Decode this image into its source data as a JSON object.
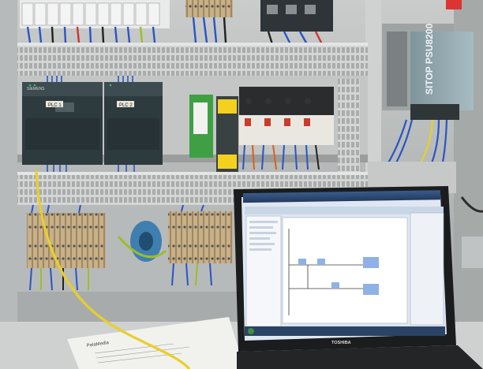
{
  "photo": {
    "plc_module_1_label": "PLC 1",
    "plc_module_2_label": "PLC 2",
    "plc_brand_label": "SIEMENS",
    "psu_label": "SITOP PSU8200",
    "laptop_brand": "TOSHIBA",
    "document_logo_text": "PelaMedia"
  },
  "colors": {
    "cabinet": "#b9bbbb",
    "plc_body": "#2d3a3e",
    "psu_body": "#8fa4ab",
    "ethernet_cable": "#e8cf2a",
    "terminal_beige": "#c8b089",
    "wire_blue": "#2a55c4",
    "wire_green_yellow": "#9bbf2a",
    "screen_window": "#dfe7f2"
  }
}
